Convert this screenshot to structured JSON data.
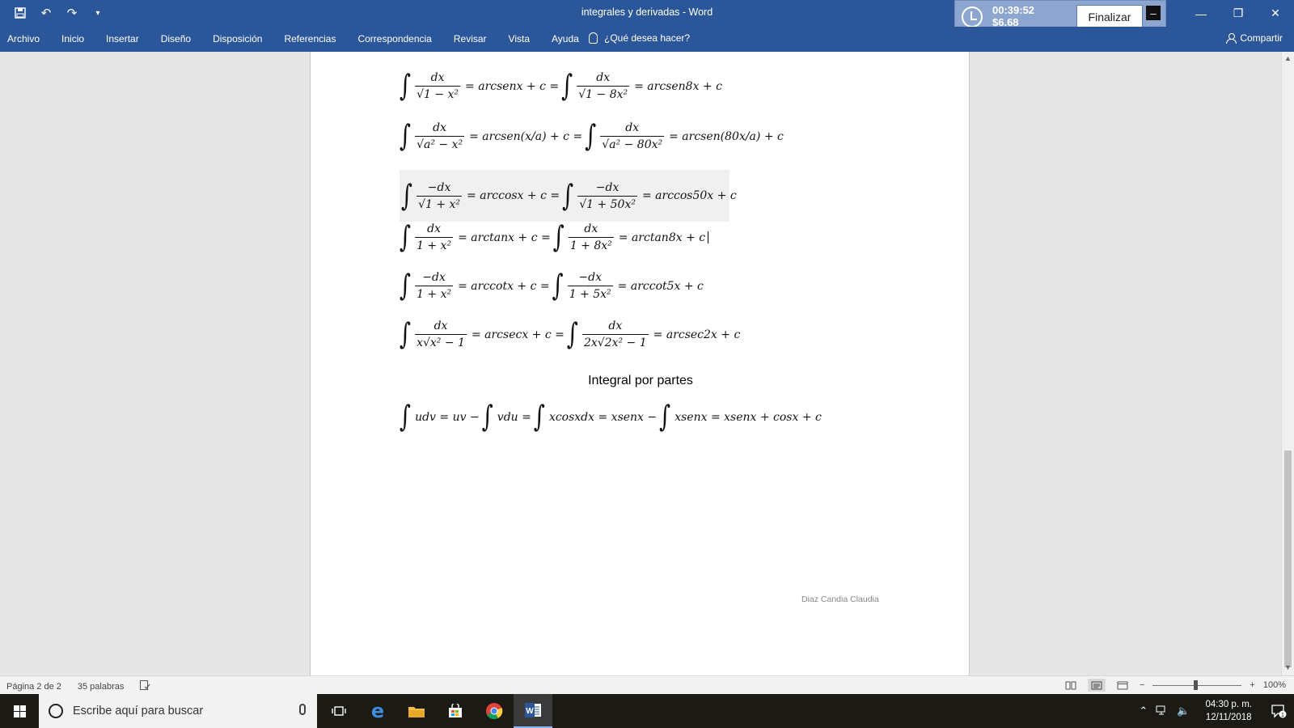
{
  "window": {
    "title": "integrales y derivadas  -  Word"
  },
  "recorder": {
    "time": "00:39:52",
    "cost": "$6.68",
    "finish_label": "Finalizar"
  },
  "ribbon": {
    "tabs": [
      "Archivo",
      "Inicio",
      "Insertar",
      "Diseño",
      "Disposición",
      "Referencias",
      "Correspondencia",
      "Revisar",
      "Vista",
      "Ayuda"
    ],
    "tell_me": "¿Qué desea hacer?",
    "share": "Compartir"
  },
  "document": {
    "equations": [
      {
        "id": "arcsen",
        "a_num": "dx",
        "a_den": "√1 − x²",
        "a_res": "= arcsenx + c =",
        "b_num": "dx",
        "b_den": "√1 − 8x²",
        "b_res": "= arcsen8x + c"
      },
      {
        "id": "arcsen-a",
        "a_num": "dx",
        "a_den": "√a² − x²",
        "a_res": "= arcsen(x/a) + c =",
        "b_num": "dx",
        "b_den": "√a² − 80x²",
        "b_res": "= arcsen(80x/a) + c"
      },
      {
        "id": "arccos",
        "a_num": "−dx",
        "a_den": "√1 + x²",
        "a_res": "= arccosx + c =",
        "b_num": "−dx",
        "b_den": "√1 + 50x²",
        "b_res": "= arccos50x + c"
      },
      {
        "id": "arctan",
        "a_num": "dx",
        "a_den": "1 + x²",
        "a_res": "= arctanx + c =",
        "b_num": "dx",
        "b_den": "1 + 8x²",
        "b_res": "= arctan8x + c"
      },
      {
        "id": "arccot",
        "a_num": "−dx",
        "a_den": "1 + x²",
        "a_res": "= arccotx + c =",
        "b_num": "−dx",
        "b_den": "1 + 5x²",
        "b_res": "= arccot5x + c"
      },
      {
        "id": "arcsec",
        "a_num": "dx",
        "a_den": "x√x² − 1",
        "a_res": "= arcsecx + c =",
        "b_num": "dx",
        "b_den": "2x√2x² − 1",
        "b_res": "= arcsec2x + c"
      }
    ],
    "section_title": "Integral por partes",
    "parts_formula": {
      "p1": "udv = uv −",
      "p2": "vdu =",
      "p3": "xcosxdx = xsenx −",
      "p4": "xsenx = xsenx + cosx + c"
    },
    "author": "Diaz Candia Claudia"
  },
  "statusbar": {
    "page": "Página 2 de 2",
    "words": "35 palabras",
    "zoom": "100%"
  },
  "taskbar": {
    "search_placeholder": "Escribe aquí para buscar",
    "time": "04:30 p. m.",
    "date": "12/11/2018",
    "notifications": "1"
  }
}
